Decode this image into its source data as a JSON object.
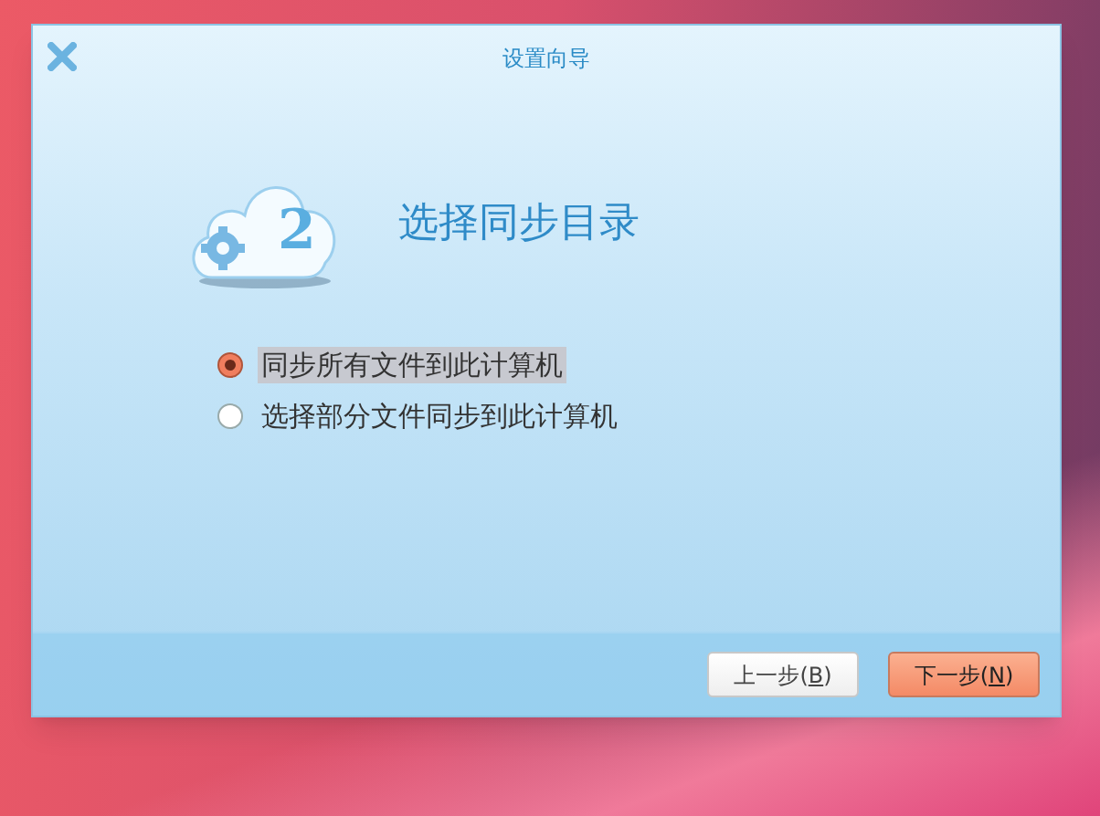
{
  "window": {
    "title": "设置向导"
  },
  "header": {
    "step": "2",
    "title": "选择同步目录"
  },
  "options": [
    {
      "label": "同步所有文件到此计算机",
      "selected": true,
      "focused": true
    },
    {
      "label": "选择部分文件同步到此计算机",
      "selected": false,
      "focused": false
    }
  ],
  "buttons": [
    {
      "kind": "secondary",
      "text_before": "上一步(",
      "mnemonic": "B",
      "text_after": ")"
    },
    {
      "kind": "primary",
      "text_before": "下一步(",
      "mnemonic": "N",
      "text_after": ")"
    }
  ]
}
